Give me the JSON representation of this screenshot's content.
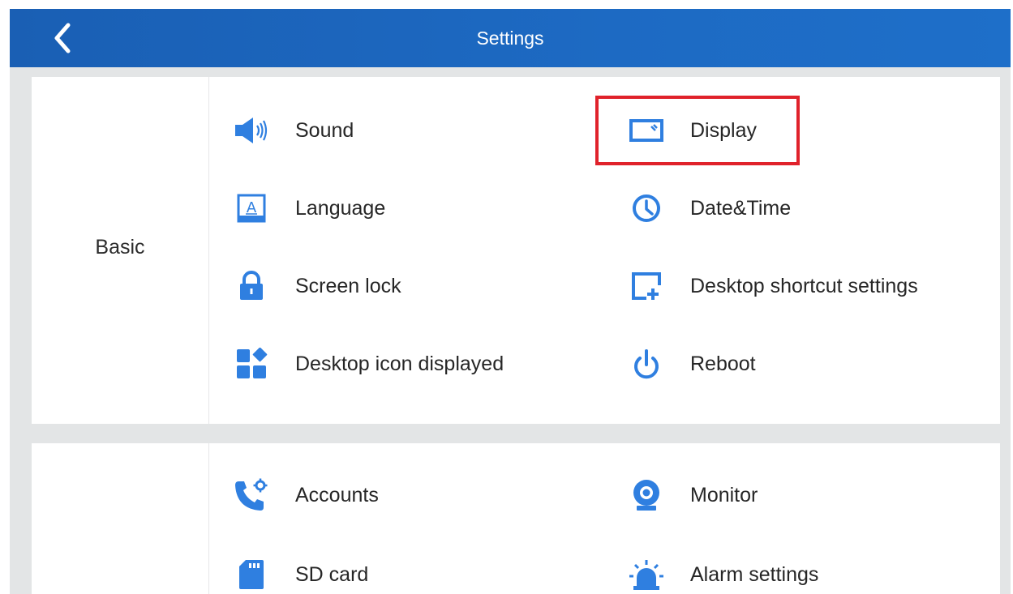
{
  "header": {
    "title": "Settings",
    "back_icon": "chevron-left-icon"
  },
  "colors": {
    "header_blue": "#1d6ac3",
    "icon_blue": "#2f7fe0",
    "highlight_red": "#e0222b",
    "background_gray": "#e3e5e6"
  },
  "sections": [
    {
      "label": "Basic",
      "items": [
        {
          "label": "Sound",
          "icon": "speaker-icon"
        },
        {
          "label": "Display",
          "icon": "display-icon",
          "highlighted": true
        },
        {
          "label": "Language",
          "icon": "language-icon"
        },
        {
          "label": "Date&Time",
          "icon": "clock-icon"
        },
        {
          "label": "Screen lock",
          "icon": "lock-icon"
        },
        {
          "label": "Desktop shortcut settings",
          "icon": "add-shortcut-icon"
        },
        {
          "label": "Desktop icon displayed",
          "icon": "grid-icon"
        },
        {
          "label": "Reboot",
          "icon": "power-icon"
        }
      ]
    },
    {
      "label": "",
      "items": [
        {
          "label": "Accounts",
          "icon": "phone-gear-icon"
        },
        {
          "label": "Monitor",
          "icon": "camera-icon"
        },
        {
          "label": "SD card",
          "icon": "sd-card-icon"
        },
        {
          "label": "Alarm settings",
          "icon": "alarm-light-icon"
        }
      ]
    }
  ]
}
